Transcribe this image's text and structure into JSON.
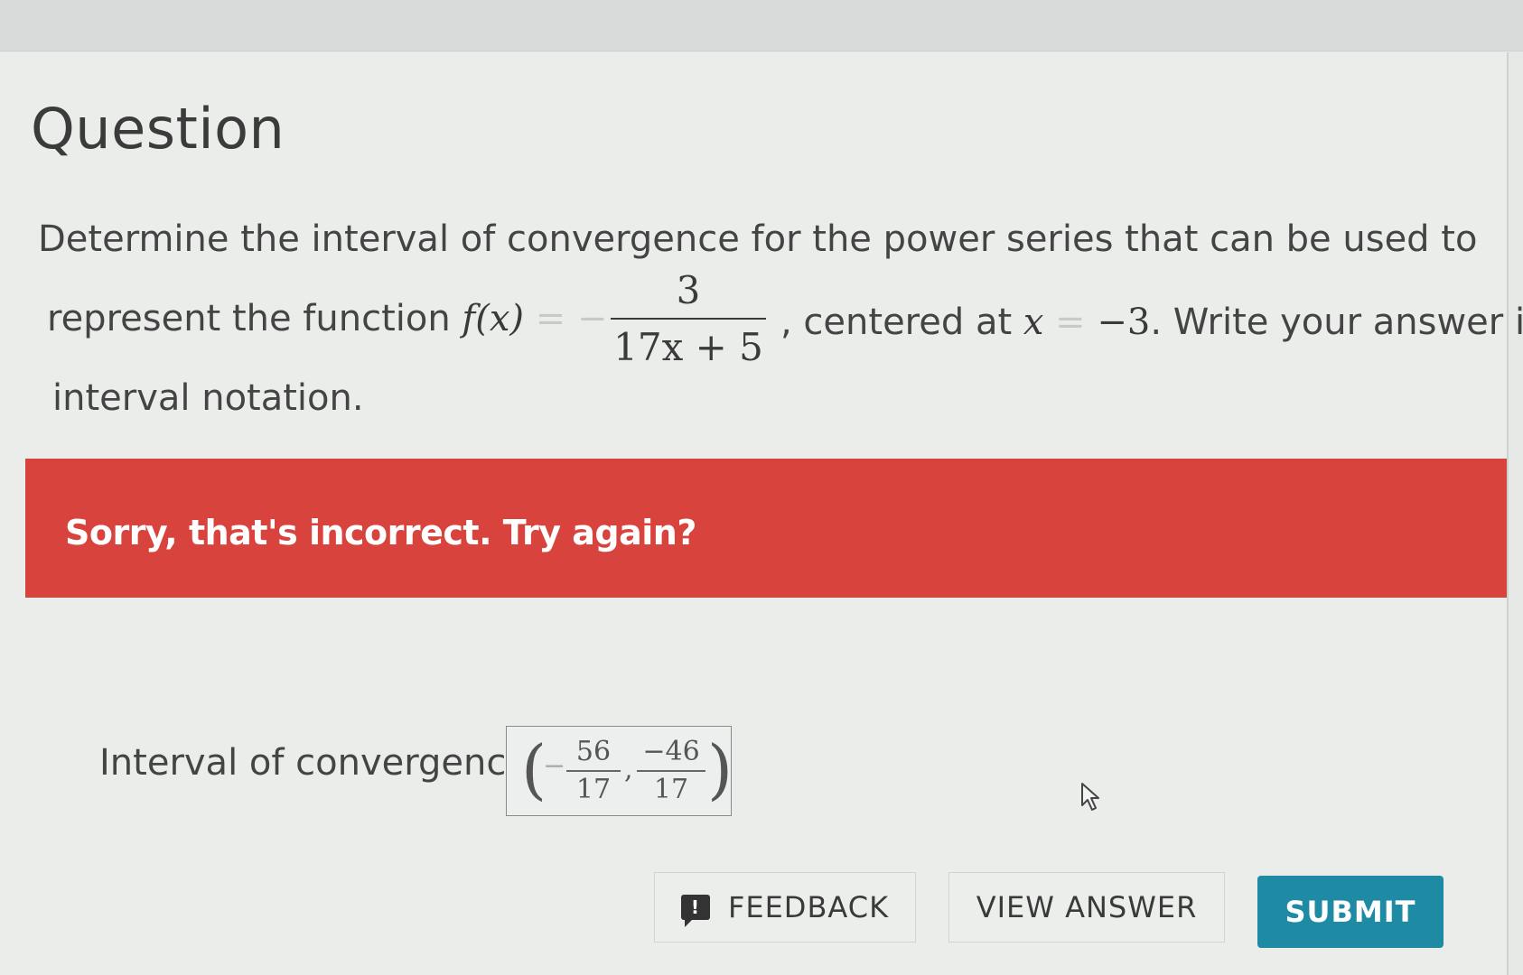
{
  "question": {
    "title": "Question",
    "line1": "Determine the interval of convergence for the power series that can be used to",
    "line2_prefix": "represent the function ",
    "fx": "f(x)",
    "eq": " = −",
    "fraction_num": "3",
    "fraction_den": "17x + 5",
    "line2_mid": ", centered at ",
    "x_var": "x",
    "eq2": " = ",
    "center": "−3",
    "line2_suffix": ". Write your answer in",
    "line3": "interval notation."
  },
  "feedback_banner": {
    "message": "Sorry, that's incorrect. Try again?",
    "color": "#d9433d"
  },
  "answer": {
    "label": "Interval of convergence:",
    "open_paren": "(",
    "close_paren": ")",
    "lower_sign": "−",
    "lower_num": "56",
    "lower_den": "17",
    "separator": ",",
    "upper_num": "−46",
    "upper_den": "17"
  },
  "buttons": {
    "feedback_label": "FEEDBACK",
    "feedback_icon_glyph": "!",
    "view_answer_label": "VIEW ANSWER",
    "submit_label": "SUBMIT",
    "submit_color": "#1f8aa3"
  },
  "icons": {
    "feedback": "feedback-icon",
    "cursor": "mouse-pointer-icon"
  }
}
